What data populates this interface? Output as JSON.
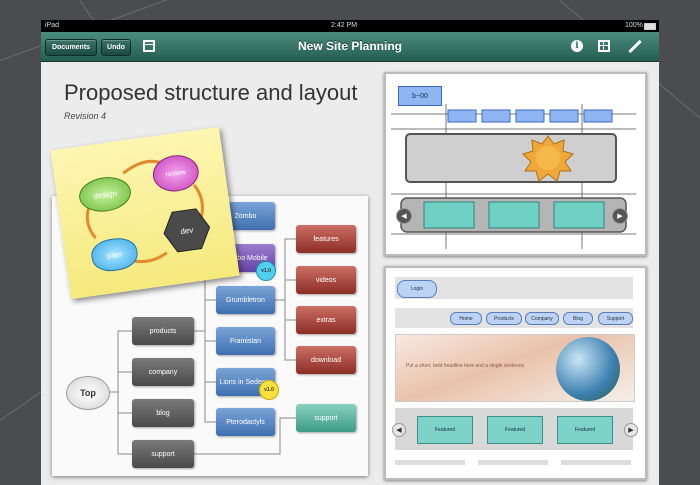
{
  "status_bar": {
    "carrier": "iPad",
    "time": "2:42 PM",
    "battery": "100%"
  },
  "toolbar": {
    "documents_label": "Documents",
    "undo_label": "Undo",
    "title": "New Site Planning",
    "accent_color": "#2f6e61"
  },
  "slide": {
    "title": "Proposed structure and layout",
    "subtitle": "Revision 4"
  },
  "sticky_note": {
    "nodes": {
      "design": "design",
      "review": "review",
      "plan": "plan",
      "dev": "dev"
    }
  },
  "diagram": {
    "root": "Top",
    "level1": [
      "products",
      "company",
      "blog",
      "support"
    ],
    "level2": [
      "Zombo",
      "Zombo Mobile",
      "Grumbletron",
      "Framistan",
      "Lions in Sedecar",
      "Pterodactyls"
    ],
    "level3": [
      "features",
      "videos",
      "extras",
      "download",
      "support"
    ],
    "badges": [
      "v1.0",
      "v1.0"
    ]
  },
  "wireframe_top": {
    "logo_text": "b~00",
    "nav_arrows": {
      "left": "◀",
      "right": "▶"
    }
  },
  "wireframe_bottom": {
    "login_label": "Login",
    "nav": [
      "Home",
      "Products",
      "Company",
      "Blog",
      "Support"
    ],
    "hero_text": "Put a short, bold headline here and a single sentence",
    "featured": [
      "Featured",
      "Featured",
      "Featured"
    ],
    "nav_arrows": {
      "left": "◀",
      "right": "▶"
    }
  }
}
